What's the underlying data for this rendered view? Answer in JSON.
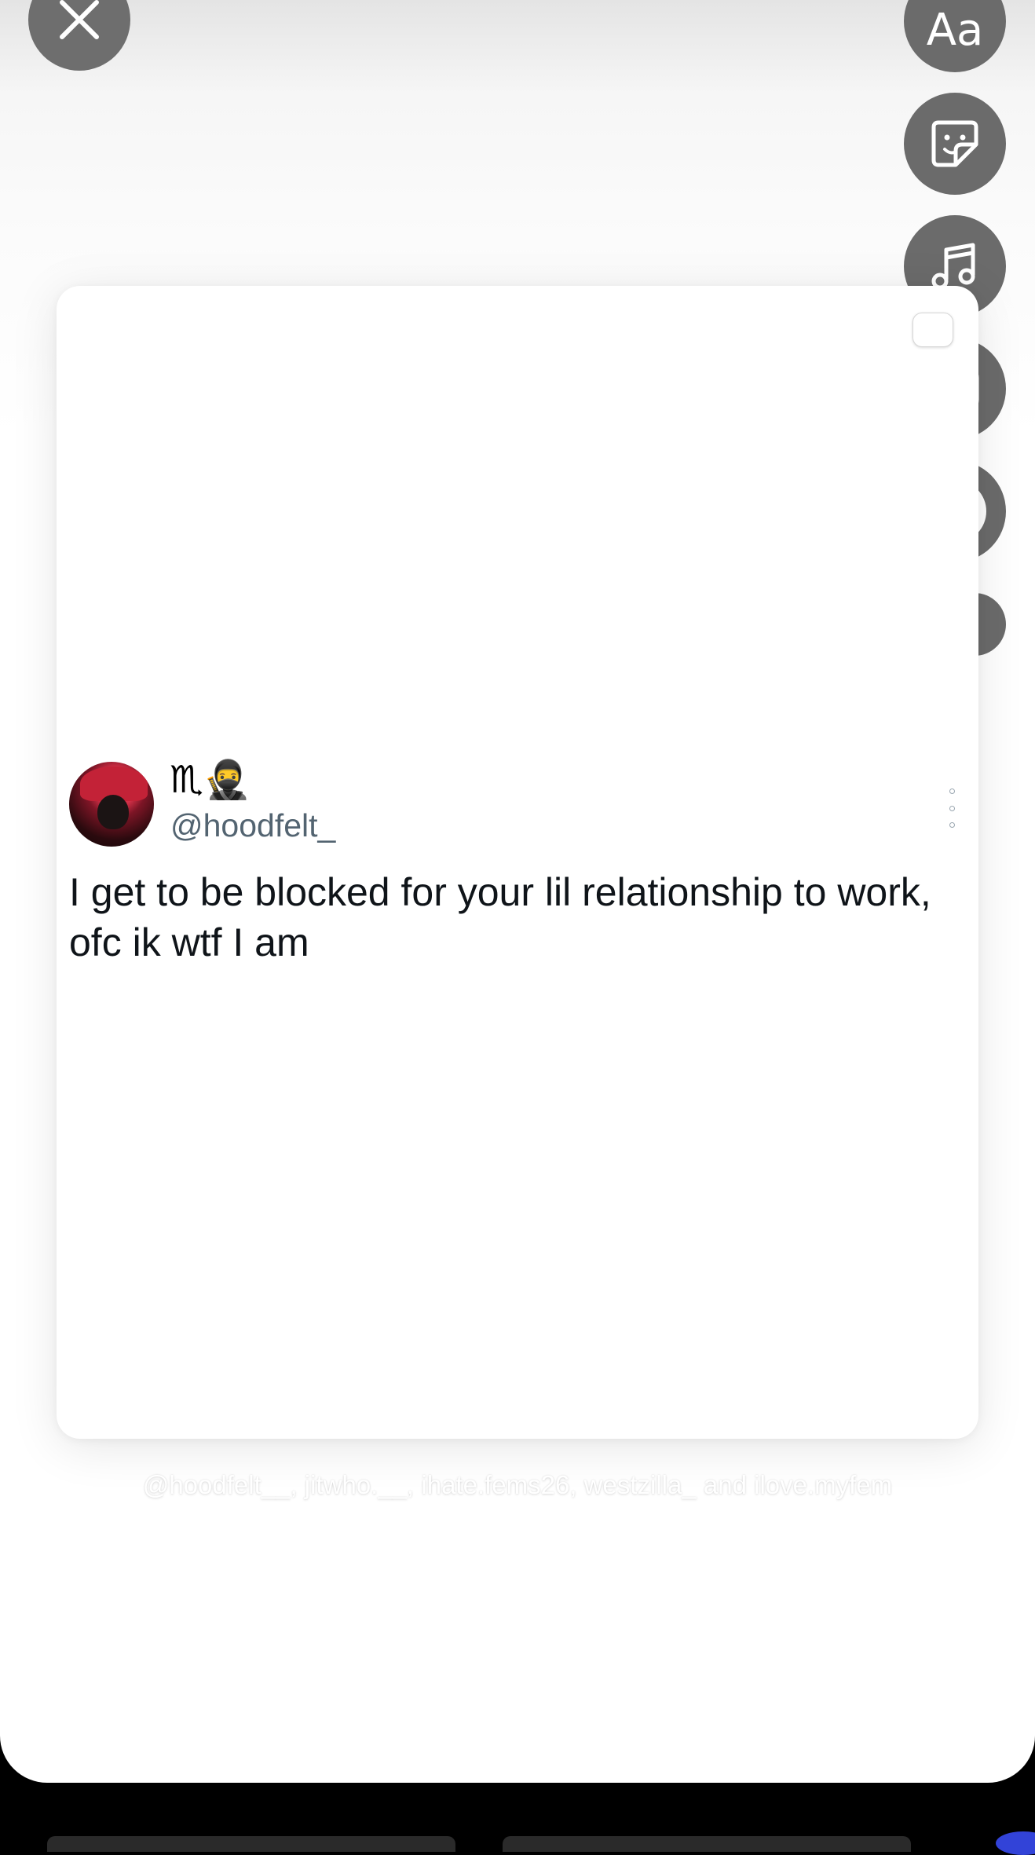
{
  "toolbar": {
    "text_tool_label": "Aa",
    "icons": [
      "close-icon",
      "sticker-icon",
      "music-note-icon",
      "mention-icon",
      "record-ring-icon",
      "chevron-down-icon"
    ]
  },
  "tweet": {
    "display_name": "♏🥷",
    "handle": "@hoodfelt_",
    "text": "I get to be blocked for your lil relationship to work, ofc ik wtf I am"
  },
  "mentions_line": "@hoodfelt__, jitwho.__, ihate.fems26, westzilla_ and ilove.myfem",
  "colors": {
    "button_bg": "#6b6b6b",
    "handle": "#536471",
    "tweet_text": "#0f1419",
    "zodiac_badge": "#9b58d3"
  }
}
